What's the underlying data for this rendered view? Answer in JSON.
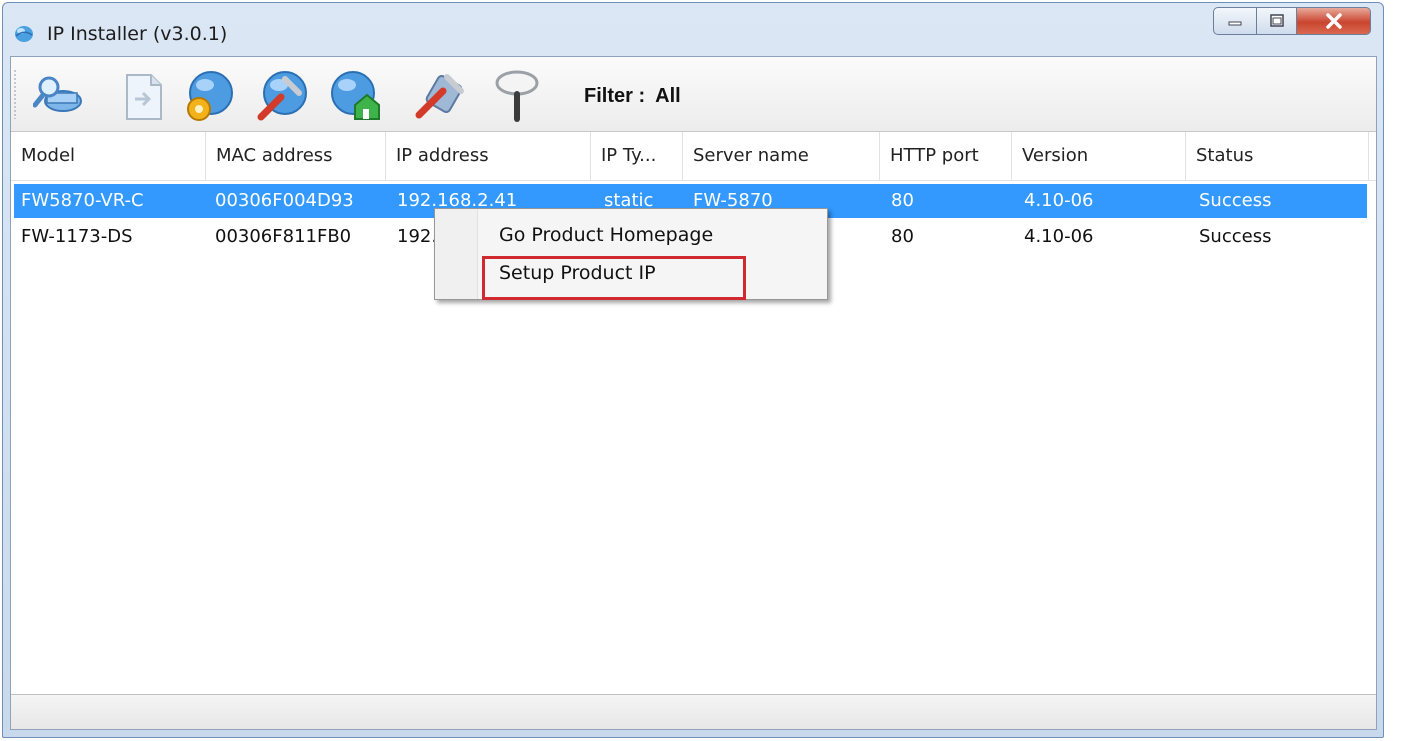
{
  "window": {
    "title": "IP Installer (v3.0.1)",
    "controls": {
      "minimize": "minimize",
      "maximize": "maximize",
      "close": "close"
    }
  },
  "toolbar": {
    "icons": [
      "search-devices-icon",
      "document-icon",
      "settings-globe-icon",
      "tools-globe-icon",
      "home-globe-icon",
      "config-tools-icon",
      "magnifier-icon"
    ],
    "filter_label": "Filter :",
    "filter_value": "All"
  },
  "table": {
    "columns": [
      "Model",
      "MAC address",
      "IP address",
      "IP Ty...",
      "Server name",
      "HTTP port",
      "Version",
      "Status"
    ],
    "rows": [
      {
        "model": "FW5870-VR-C",
        "mac": "00306F004D93",
        "ip": "192.168.2.41",
        "ip_type": "static",
        "server": "FW-5870",
        "http_port": "80",
        "version": "4.10-06",
        "status": "Success",
        "selected": true
      },
      {
        "model": "FW-1173-DS",
        "mac": "00306F811FB0",
        "ip": "192.",
        "ip_type": "",
        "server": "",
        "http_port": "80",
        "version": "4.10-06",
        "status": "Success",
        "selected": false
      }
    ]
  },
  "context_menu": {
    "items": [
      "Go Product Homepage",
      "Setup Product IP"
    ],
    "highlighted": "Setup Product IP"
  },
  "colors": {
    "selection": "#3399ff",
    "highlight_box": "#d0292f"
  }
}
